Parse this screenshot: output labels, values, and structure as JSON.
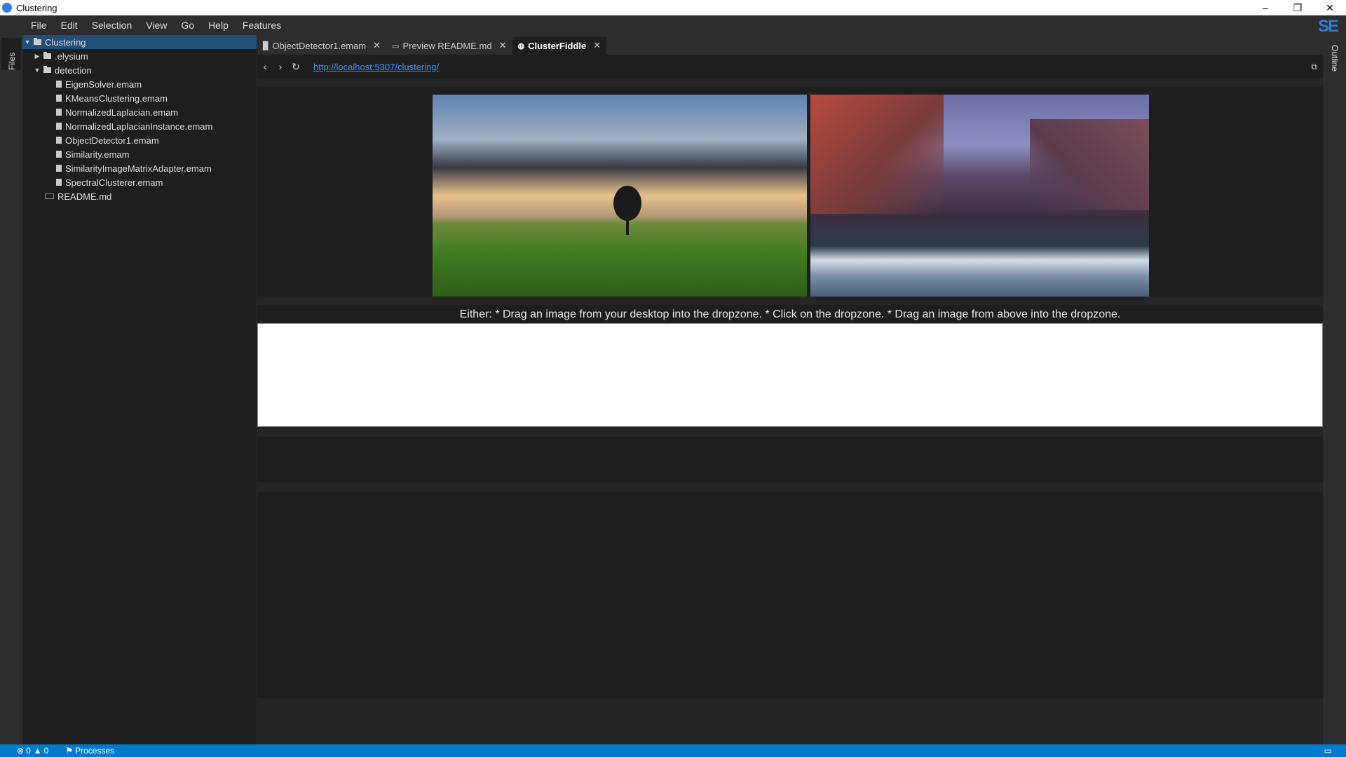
{
  "window": {
    "title": "Clustering",
    "controls": [
      "–",
      "❐",
      "✕"
    ]
  },
  "menu": [
    "File",
    "Edit",
    "Selection",
    "View",
    "Go",
    "Help",
    "Features"
  ],
  "logo": "SE",
  "left_strip": {
    "files_label": "Files"
  },
  "right_strip": {
    "outline_label": "Outline"
  },
  "tree": [
    {
      "label": "Clustering",
      "kind": "folder",
      "expanded": true,
      "depth": 0,
      "selected": true
    },
    {
      "label": ".elysium",
      "kind": "folder",
      "expanded": false,
      "depth": 1
    },
    {
      "label": "detection",
      "kind": "folder",
      "expanded": true,
      "depth": 1
    },
    {
      "label": "EigenSolver.emam",
      "kind": "file",
      "depth": 2
    },
    {
      "label": "KMeansClustering.emam",
      "kind": "file",
      "depth": 2
    },
    {
      "label": "NormalizedLaplacian.emam",
      "kind": "file",
      "depth": 2
    },
    {
      "label": "NormalizedLaplacianInstance.emam",
      "kind": "file",
      "depth": 2
    },
    {
      "label": "ObjectDetector1.emam",
      "kind": "file",
      "depth": 2
    },
    {
      "label": "Similarity.emam",
      "kind": "file",
      "depth": 2
    },
    {
      "label": "SimilarityImageMatrixAdapter.emam",
      "kind": "file",
      "depth": 2
    },
    {
      "label": "SpectralClusterer.emam",
      "kind": "file",
      "depth": 2
    },
    {
      "label": "README.md",
      "kind": "markdown",
      "depth": 1
    }
  ],
  "tabs": [
    {
      "label": "ObjectDetector1.emam",
      "icon": "file-icon",
      "active": false
    },
    {
      "label": "Preview README.md",
      "icon": "preview-icon",
      "active": false
    },
    {
      "label": "ClusterFiddle",
      "icon": "globe-icon",
      "active": true
    }
  ],
  "browser": {
    "url": "http://localhost:5307/clustering/"
  },
  "page": {
    "instructions": "Either: * Drag an image from your desktop into the dropzone. * Click on the dropzone. * Drag an image from above into the dropzone."
  },
  "status": {
    "errors": "0",
    "warnings": "0",
    "processes": "Processes"
  }
}
